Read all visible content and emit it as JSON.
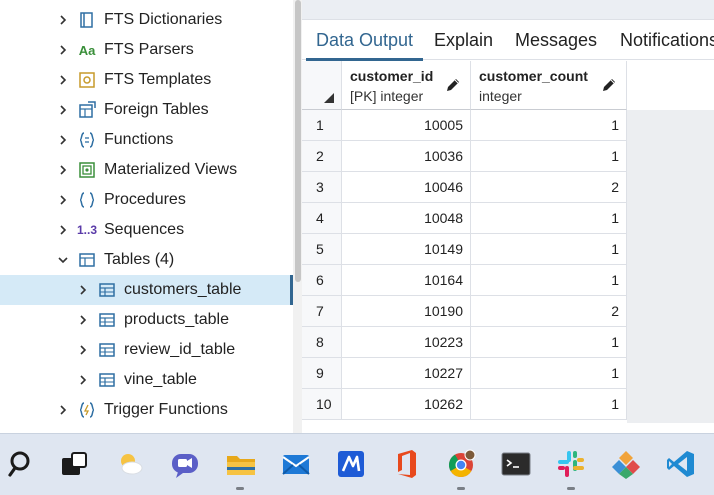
{
  "tree": {
    "items": [
      {
        "label": "FTS Dictionaries",
        "icon": "book-icon",
        "level": 1,
        "expanded": false
      },
      {
        "label": "FTS Parsers",
        "icon": "aa-text-icon",
        "icon_text": "Aa",
        "level": 1,
        "expanded": false
      },
      {
        "label": "FTS Templates",
        "icon": "template-icon",
        "level": 1,
        "expanded": false
      },
      {
        "label": "Foreign Tables",
        "icon": "foreign-table-icon",
        "level": 1,
        "expanded": false
      },
      {
        "label": "Functions",
        "icon": "function-icon",
        "level": 1,
        "expanded": false
      },
      {
        "label": "Materialized Views",
        "icon": "materialized-view-icon",
        "level": 1,
        "expanded": false
      },
      {
        "label": "Procedures",
        "icon": "procedure-icon",
        "level": 1,
        "expanded": false
      },
      {
        "label": "Sequences",
        "icon": "sequence-icon",
        "icon_text": "1..3",
        "level": 1,
        "expanded": false
      },
      {
        "label": "Tables (4)",
        "icon": "tables-icon",
        "level": 1,
        "expanded": true
      },
      {
        "label": "customers_table",
        "icon": "table-icon",
        "level": 2,
        "expanded": false,
        "selected": true
      },
      {
        "label": "products_table",
        "icon": "table-icon",
        "level": 2,
        "expanded": false
      },
      {
        "label": "review_id_table",
        "icon": "table-icon",
        "level": 2,
        "expanded": false
      },
      {
        "label": "vine_table",
        "icon": "table-icon",
        "level": 2,
        "expanded": false
      },
      {
        "label": "Trigger Functions",
        "icon": "trigger-function-icon",
        "level": 1,
        "expanded": false
      },
      {
        "label": "",
        "icon": "types-icon",
        "level": 1,
        "expanded": false
      }
    ]
  },
  "tabs": [
    {
      "label": "Data Output",
      "active": true
    },
    {
      "label": "Explain",
      "active": false
    },
    {
      "label": "Messages",
      "active": false
    },
    {
      "label": "Notifications",
      "active": false
    }
  ],
  "grid": {
    "columns": [
      {
        "name": "customer_id",
        "type": "[PK] integer"
      },
      {
        "name": "customer_count",
        "type": "integer"
      }
    ],
    "rows": [
      {
        "n": "1",
        "customer_id": "10005",
        "customer_count": "1"
      },
      {
        "n": "2",
        "customer_id": "10036",
        "customer_count": "1"
      },
      {
        "n": "3",
        "customer_id": "10046",
        "customer_count": "2"
      },
      {
        "n": "4",
        "customer_id": "10048",
        "customer_count": "1"
      },
      {
        "n": "5",
        "customer_id": "10149",
        "customer_count": "1"
      },
      {
        "n": "6",
        "customer_id": "10164",
        "customer_count": "1"
      },
      {
        "n": "7",
        "customer_id": "10190",
        "customer_count": "2"
      },
      {
        "n": "8",
        "customer_id": "10223",
        "customer_count": "1"
      },
      {
        "n": "9",
        "customer_id": "10227",
        "customer_count": "1"
      },
      {
        "n": "10",
        "customer_id": "10262",
        "customer_count": "1"
      }
    ]
  },
  "taskbar": {
    "apps": [
      {
        "name": "search-icon",
        "running": false
      },
      {
        "name": "task-view-icon",
        "running": false
      },
      {
        "name": "weather-widget-icon",
        "running": false
      },
      {
        "name": "teams-chat-icon",
        "running": false
      },
      {
        "name": "file-explorer-icon",
        "running": true
      },
      {
        "name": "mail-icon",
        "running": false
      },
      {
        "name": "vscode-alt-icon",
        "running": false
      },
      {
        "name": "office-icon",
        "running": false
      },
      {
        "name": "chrome-icon",
        "running": true
      },
      {
        "name": "terminal-icon",
        "running": false
      },
      {
        "name": "slack-icon",
        "running": true
      },
      {
        "name": "git-kraken-icon",
        "running": false
      },
      {
        "name": "visual-studio-code-icon",
        "running": false
      }
    ]
  },
  "colors": {
    "accent": "#326690",
    "selected_row": "#d5eaf7",
    "icon_blue": "#2f6fa3",
    "icon_green": "#3a8f3a"
  }
}
